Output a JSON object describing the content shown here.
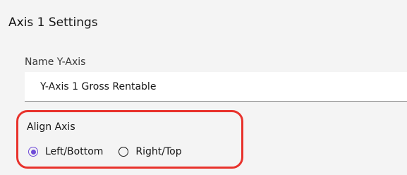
{
  "section": {
    "title": "Axis 1 Settings"
  },
  "name_field": {
    "label": "Name Y-Axis",
    "value": "Y-Axis 1 Gross Rentable"
  },
  "align_axis": {
    "label": "Align Axis",
    "options": [
      {
        "label": "Left/Bottom",
        "selected": true
      },
      {
        "label": "Right/Top",
        "selected": false
      }
    ]
  },
  "colors": {
    "accent": "#6f4bd8",
    "highlight_border": "#e8322c",
    "panel_bg": "#f4f4f4"
  }
}
